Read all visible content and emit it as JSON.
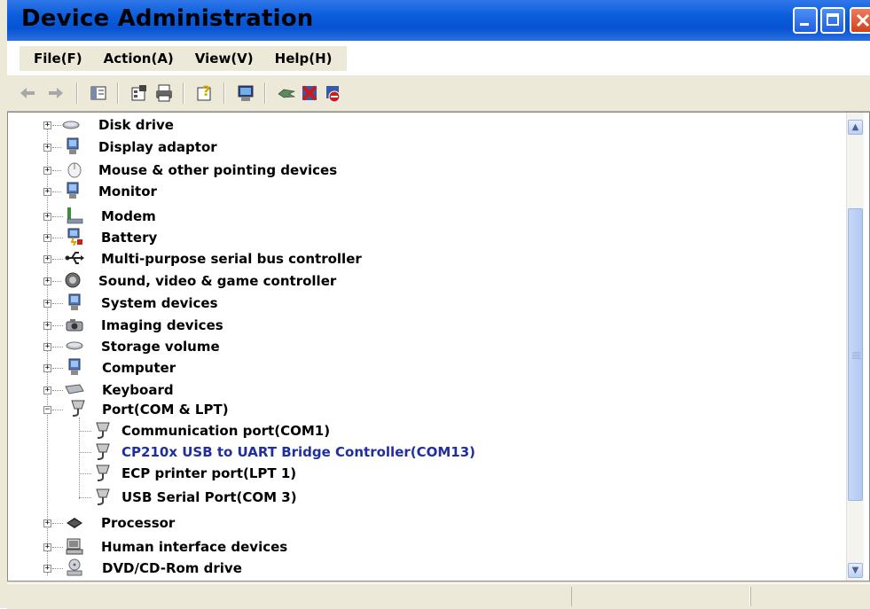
{
  "window": {
    "title": "Device Administration",
    "controls": {
      "minimize": "minimize-button",
      "maximize": "maximize-button",
      "close": "close-button"
    }
  },
  "menu": {
    "items": [
      {
        "label": "File(F)"
      },
      {
        "label": "Action(A)"
      },
      {
        "label": "View(V)"
      },
      {
        "label": "Help(H)"
      }
    ]
  },
  "toolbar": {
    "icons": [
      "back-arrow-icon",
      "forward-arrow-icon",
      "show-hide-tree-icon",
      "properties-icon",
      "print-icon",
      "help-icon",
      "scan-hardware-icon",
      "update-driver-icon",
      "uninstall-icon",
      "disable-icon"
    ]
  },
  "tree": {
    "categories": [
      {
        "label": "Disk drive",
        "icon": "disk-drive-icon",
        "expanded": false
      },
      {
        "label": "Display adaptor",
        "icon": "display-adapter-icon",
        "expanded": false
      },
      {
        "label": "Mouse & other pointing devices",
        "icon": "mouse-icon",
        "expanded": false
      },
      {
        "label": "Monitor",
        "icon": "monitor-icon",
        "expanded": false
      },
      {
        "label": "Modem",
        "icon": "modem-icon",
        "expanded": false
      },
      {
        "label": "Battery",
        "icon": "battery-icon",
        "expanded": false
      },
      {
        "label": "Multi-purpose serial bus controller",
        "icon": "usb-icon",
        "expanded": false
      },
      {
        "label": "Sound, video & game controller",
        "icon": "sound-icon",
        "expanded": false
      },
      {
        "label": "System devices",
        "icon": "system-devices-icon",
        "expanded": false
      },
      {
        "label": "Imaging devices",
        "icon": "imaging-devices-icon",
        "expanded": false
      },
      {
        "label": "Storage volume",
        "icon": "storage-volume-icon",
        "expanded": false
      },
      {
        "label": "Computer",
        "icon": "computer-icon",
        "expanded": false
      },
      {
        "label": "Keyboard",
        "icon": "keyboard-icon",
        "expanded": false
      },
      {
        "label": "Port(COM & LPT)",
        "icon": "port-icon",
        "expanded": true,
        "children": [
          {
            "label": "Communication port(COM1)",
            "icon": "port-icon"
          },
          {
            "label": "CP210x USB to UART Bridge Controller(COM13)",
            "icon": "port-icon",
            "highlighted": true
          },
          {
            "label": "ECP printer port(LPT 1)",
            "icon": "port-icon"
          },
          {
            "label": "USB Serial Port(COM 3)",
            "icon": "port-icon"
          }
        ]
      },
      {
        "label": "Processor",
        "icon": "processor-icon",
        "expanded": false
      },
      {
        "label": "Human interface devices",
        "icon": "hid-icon",
        "expanded": false
      },
      {
        "label": "DVD/CD-Rom drive",
        "icon": "dvd-drive-icon",
        "expanded": false
      }
    ]
  },
  "colors": {
    "title_bar": "#0754d2",
    "selected_text": "#1f2fa0",
    "chrome": "#ece9d8"
  },
  "scrollbar": {
    "position_fraction": 0.45
  }
}
